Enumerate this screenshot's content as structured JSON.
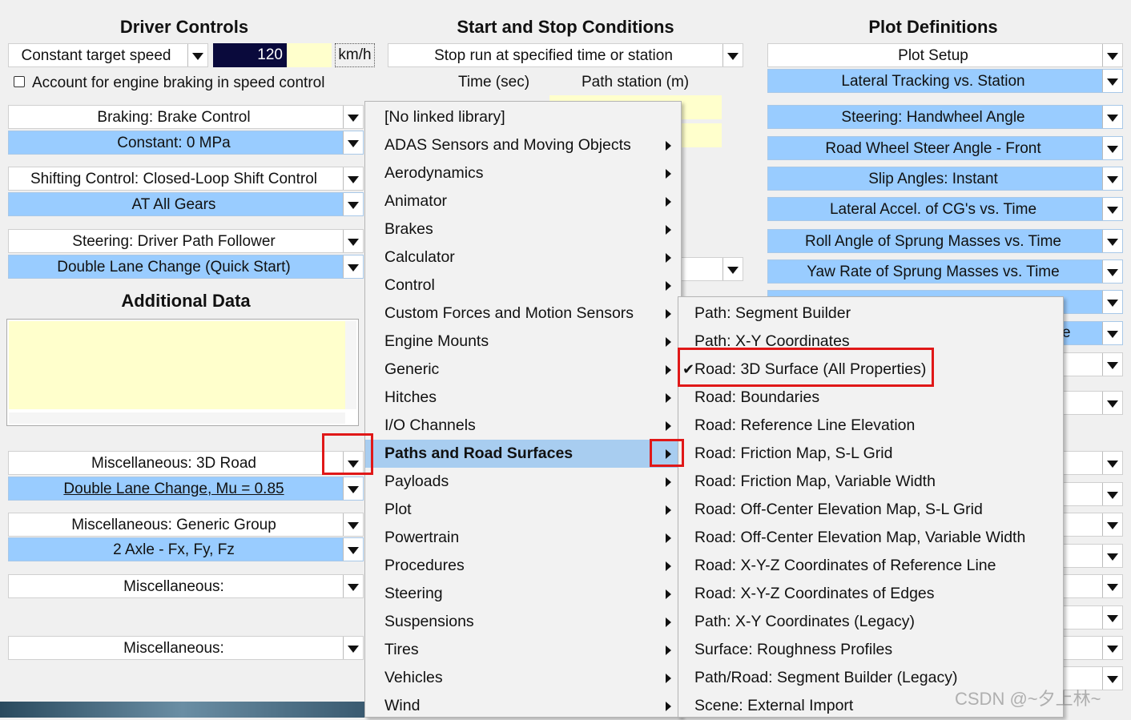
{
  "headers": {
    "driver": "Driver Controls",
    "start_stop": "Start and Stop Conditions",
    "plot": "Plot Definitions",
    "additional": "Additional Data"
  },
  "driver": {
    "speed_mode": "Constant target speed",
    "speed_value": "120",
    "speed_unit": "km/h",
    "engine_braking_label": "Account for engine braking in speed control",
    "engine_braking_checked": false,
    "controls": [
      {
        "top": "Braking: Brake Control",
        "bottom": "Constant: 0 MPa"
      },
      {
        "top": "Shifting Control: Closed-Loop Shift Control",
        "bottom": "AT All Gears"
      },
      {
        "top": "Steering: Driver Path Follower",
        "bottom": "Double Lane Change (Quick Start)"
      }
    ]
  },
  "misc": [
    {
      "top": "Miscellaneous: 3D Road",
      "bottom": "Double Lane Change, Mu = 0.85"
    },
    {
      "top": "Miscellaneous: Generic Group",
      "bottom": "2 Axle - Fx, Fy, Fz"
    },
    {
      "top": "Miscellaneous:"
    },
    {
      "top": "Miscellaneous:"
    }
  ],
  "start_stop": {
    "mode": "Stop run at specified time or station",
    "time_label": "Time (sec)",
    "station_label": "Path station (m)"
  },
  "plot": {
    "setup": "Plot Setup",
    "items": [
      "Lateral Tracking vs. Station",
      "Steering: Handwheel Angle",
      "Road Wheel Steer Angle - Front",
      "Slip Angles: Instant",
      "Lateral Accel. of CG's vs. Time",
      "Roll Angle of Sprung Masses vs. Time",
      "Yaw Rate of Sprung Masses vs. Time"
    ],
    "partial_item_text": "e"
  },
  "menu": {
    "items": [
      {
        "label": "[No linked library]",
        "sub": false
      },
      {
        "label": "ADAS Sensors and Moving Objects",
        "sub": true
      },
      {
        "label": "Aerodynamics",
        "sub": true
      },
      {
        "label": "Animator",
        "sub": true
      },
      {
        "label": "Brakes",
        "sub": true
      },
      {
        "label": "Calculator",
        "sub": true
      },
      {
        "label": "Control",
        "sub": true
      },
      {
        "label": "Custom Forces and Motion Sensors",
        "sub": true
      },
      {
        "label": "Engine Mounts",
        "sub": true
      },
      {
        "label": "Generic",
        "sub": true
      },
      {
        "label": "Hitches",
        "sub": true
      },
      {
        "label": "I/O Channels",
        "sub": true
      },
      {
        "label": "Paths and Road Surfaces",
        "sub": true,
        "highlighted": true
      },
      {
        "label": "Payloads",
        "sub": true
      },
      {
        "label": "Plot",
        "sub": true
      },
      {
        "label": "Powertrain",
        "sub": true
      },
      {
        "label": "Procedures",
        "sub": true
      },
      {
        "label": "Steering",
        "sub": true
      },
      {
        "label": "Suspensions",
        "sub": true
      },
      {
        "label": "Tires",
        "sub": true
      },
      {
        "label": "Vehicles",
        "sub": true
      },
      {
        "label": "Wind",
        "sub": true
      }
    ]
  },
  "submenu": {
    "items": [
      {
        "label": "Path: Segment Builder"
      },
      {
        "label": "Path: X-Y Coordinates"
      },
      {
        "label": "Road: 3D Surface (All Properties)",
        "checked": true
      },
      {
        "label": "Road: Boundaries"
      },
      {
        "label": "Road: Reference Line Elevation"
      },
      {
        "label": "Road: Friction Map, S-L Grid"
      },
      {
        "label": "Road: Friction Map, Variable Width"
      },
      {
        "label": "Road: Off-Center Elevation Map, S-L Grid"
      },
      {
        "label": "Road: Off-Center Elevation Map, Variable Width"
      },
      {
        "label": "Road: X-Y-Z Coordinates of Reference Line"
      },
      {
        "label": "Road: X-Y-Z Coordinates of Edges"
      },
      {
        "label": "Path: X-Y Coordinates (Legacy)"
      },
      {
        "label": "Surface: Roughness Profiles"
      },
      {
        "label": "Path/Road: Segment Builder (Legacy)"
      },
      {
        "label": "Scene: External Import"
      }
    ],
    "check_glyph": "✔"
  },
  "watermark": "CSDN @~夕上林~",
  "colors": {
    "accent_blue": "#99ccff",
    "highlight_red": "#e01818",
    "input_yellow": "#ffffcc"
  }
}
